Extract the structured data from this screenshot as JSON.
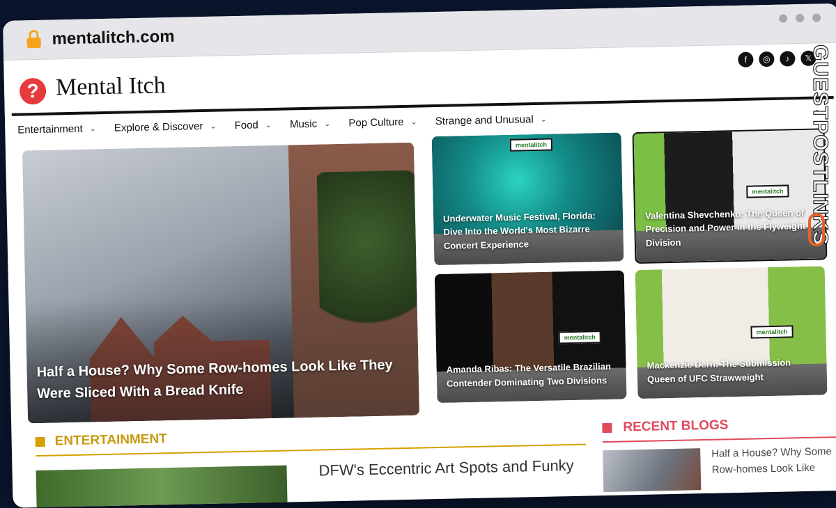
{
  "browser": {
    "url": "mentalitch.com"
  },
  "site": {
    "name": "Mental Itch",
    "logo_glyph": "?",
    "socials": [
      {
        "icon": "facebook-icon",
        "glyph": "f"
      },
      {
        "icon": "instagram-icon",
        "glyph": "◎"
      },
      {
        "icon": "tiktok-icon",
        "glyph": "♪"
      },
      {
        "icon": "x-icon",
        "glyph": "𝕏"
      }
    ]
  },
  "nav": {
    "items": [
      "Entertainment",
      "Explore & Discover",
      "Food",
      "Music",
      "Pop Culture",
      "Strange and Unusual"
    ],
    "chevron": "⌄",
    "search_glyph": "⌕"
  },
  "featured": {
    "hero_title": "Half a House? Why Some Row-homes Look Like They Were Sliced With a Bread Knife",
    "cards": [
      "Underwater Music Festival, Florida: Dive Into the World's Most Bizarre Concert Experience",
      "Valentina Shevchenko: The Queen of Precision and Power in the Flyweight Division",
      "Amanda Ribas: The Versatile Brazilian Contender Dominating Two Divisions",
      "Mackenzie Dern: The Submission Queen of UFC Strawweight"
    ],
    "logo_text": "mentalitch"
  },
  "sections": {
    "entertainment": "ENTERTAINMENT",
    "entertainment_article": "DFW's Eccentric Art Spots and Funky",
    "recent_blogs": "RECENT BLOGS",
    "recent_article": "Half a House? Why Some Row-homes Look Like"
  },
  "watermark": {
    "text": "GUESTPOSTLINKS"
  },
  "colors": {
    "accent_gold": "#d6a100",
    "accent_red": "#e04a5a",
    "logo_red": "#e63b3b",
    "lock": "#f4a51c"
  }
}
